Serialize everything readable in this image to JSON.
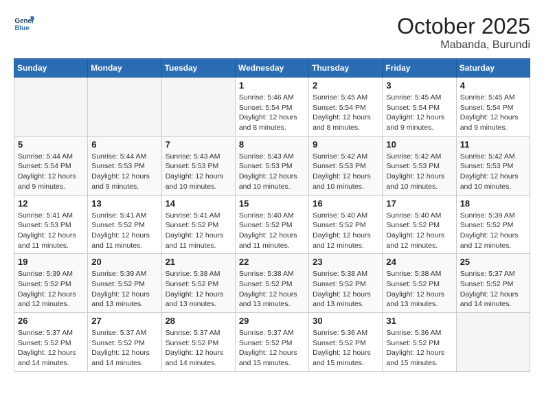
{
  "header": {
    "logo_line1": "General",
    "logo_line2": "Blue",
    "month": "October 2025",
    "location": "Mabanda, Burundi"
  },
  "weekdays": [
    "Sunday",
    "Monday",
    "Tuesday",
    "Wednesday",
    "Thursday",
    "Friday",
    "Saturday"
  ],
  "weeks": [
    [
      {
        "day": "",
        "info": ""
      },
      {
        "day": "",
        "info": ""
      },
      {
        "day": "",
        "info": ""
      },
      {
        "day": "1",
        "info": "Sunrise: 5:46 AM\nSunset: 5:54 PM\nDaylight: 12 hours and 8 minutes."
      },
      {
        "day": "2",
        "info": "Sunrise: 5:45 AM\nSunset: 5:54 PM\nDaylight: 12 hours and 8 minutes."
      },
      {
        "day": "3",
        "info": "Sunrise: 5:45 AM\nSunset: 5:54 PM\nDaylight: 12 hours and 9 minutes."
      },
      {
        "day": "4",
        "info": "Sunrise: 5:45 AM\nSunset: 5:54 PM\nDaylight: 12 hours and 9 minutes."
      }
    ],
    [
      {
        "day": "5",
        "info": "Sunrise: 5:44 AM\nSunset: 5:54 PM\nDaylight: 12 hours and 9 minutes."
      },
      {
        "day": "6",
        "info": "Sunrise: 5:44 AM\nSunset: 5:53 PM\nDaylight: 12 hours and 9 minutes."
      },
      {
        "day": "7",
        "info": "Sunrise: 5:43 AM\nSunset: 5:53 PM\nDaylight: 12 hours and 10 minutes."
      },
      {
        "day": "8",
        "info": "Sunrise: 5:43 AM\nSunset: 5:53 PM\nDaylight: 12 hours and 10 minutes."
      },
      {
        "day": "9",
        "info": "Sunrise: 5:42 AM\nSunset: 5:53 PM\nDaylight: 12 hours and 10 minutes."
      },
      {
        "day": "10",
        "info": "Sunrise: 5:42 AM\nSunset: 5:53 PM\nDaylight: 12 hours and 10 minutes."
      },
      {
        "day": "11",
        "info": "Sunrise: 5:42 AM\nSunset: 5:53 PM\nDaylight: 12 hours and 10 minutes."
      }
    ],
    [
      {
        "day": "12",
        "info": "Sunrise: 5:41 AM\nSunset: 5:53 PM\nDaylight: 12 hours and 11 minutes."
      },
      {
        "day": "13",
        "info": "Sunrise: 5:41 AM\nSunset: 5:52 PM\nDaylight: 12 hours and 11 minutes."
      },
      {
        "day": "14",
        "info": "Sunrise: 5:41 AM\nSunset: 5:52 PM\nDaylight: 12 hours and 11 minutes."
      },
      {
        "day": "15",
        "info": "Sunrise: 5:40 AM\nSunset: 5:52 PM\nDaylight: 12 hours and 11 minutes."
      },
      {
        "day": "16",
        "info": "Sunrise: 5:40 AM\nSunset: 5:52 PM\nDaylight: 12 hours and 12 minutes."
      },
      {
        "day": "17",
        "info": "Sunrise: 5:40 AM\nSunset: 5:52 PM\nDaylight: 12 hours and 12 minutes."
      },
      {
        "day": "18",
        "info": "Sunrise: 5:39 AM\nSunset: 5:52 PM\nDaylight: 12 hours and 12 minutes."
      }
    ],
    [
      {
        "day": "19",
        "info": "Sunrise: 5:39 AM\nSunset: 5:52 PM\nDaylight: 12 hours and 12 minutes."
      },
      {
        "day": "20",
        "info": "Sunrise: 5:39 AM\nSunset: 5:52 PM\nDaylight: 12 hours and 13 minutes."
      },
      {
        "day": "21",
        "info": "Sunrise: 5:38 AM\nSunset: 5:52 PM\nDaylight: 12 hours and 13 minutes."
      },
      {
        "day": "22",
        "info": "Sunrise: 5:38 AM\nSunset: 5:52 PM\nDaylight: 12 hours and 13 minutes."
      },
      {
        "day": "23",
        "info": "Sunrise: 5:38 AM\nSunset: 5:52 PM\nDaylight: 12 hours and 13 minutes."
      },
      {
        "day": "24",
        "info": "Sunrise: 5:38 AM\nSunset: 5:52 PM\nDaylight: 12 hours and 13 minutes."
      },
      {
        "day": "25",
        "info": "Sunrise: 5:37 AM\nSunset: 5:52 PM\nDaylight: 12 hours and 14 minutes."
      }
    ],
    [
      {
        "day": "26",
        "info": "Sunrise: 5:37 AM\nSunset: 5:52 PM\nDaylight: 12 hours and 14 minutes."
      },
      {
        "day": "27",
        "info": "Sunrise: 5:37 AM\nSunset: 5:52 PM\nDaylight: 12 hours and 14 minutes."
      },
      {
        "day": "28",
        "info": "Sunrise: 5:37 AM\nSunset: 5:52 PM\nDaylight: 12 hours and 14 minutes."
      },
      {
        "day": "29",
        "info": "Sunrise: 5:37 AM\nSunset: 5:52 PM\nDaylight: 12 hours and 15 minutes."
      },
      {
        "day": "30",
        "info": "Sunrise: 5:36 AM\nSunset: 5:52 PM\nDaylight: 12 hours and 15 minutes."
      },
      {
        "day": "31",
        "info": "Sunrise: 5:36 AM\nSunset: 5:52 PM\nDaylight: 12 hours and 15 minutes."
      },
      {
        "day": "",
        "info": ""
      }
    ]
  ]
}
